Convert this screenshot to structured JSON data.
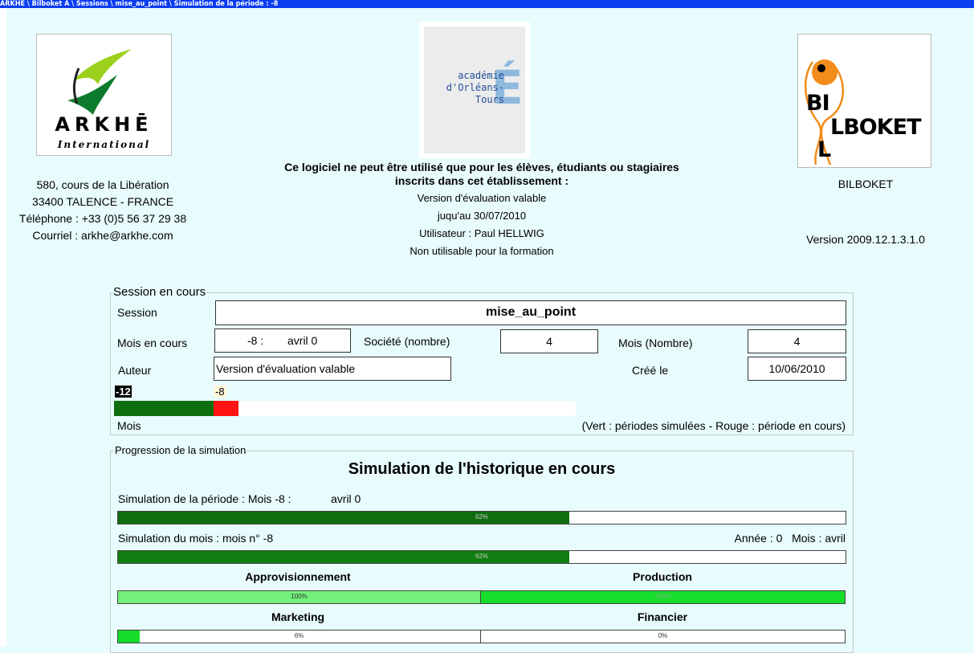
{
  "window": {
    "title": "ARKHE \\ Bilboket A \\ Sessions \\ mise_au_point \\ Simulation de la période : -8"
  },
  "logos": {
    "arkhe": {
      "name": "ARKHĒ",
      "tagline": "International"
    },
    "academie": {
      "line1": "académie",
      "line2": "d'Orléans-Tours",
      "letter": "É"
    },
    "bilboket": {
      "part1": "BI",
      "part2": "LBOKET",
      "part3": "L"
    }
  },
  "company": {
    "address": "580, cours de la Libération",
    "city": "33400 TALENCE - FRANCE",
    "phone": "Téléphone : +33 (0)5 56 37 29 38",
    "email": "Courriel : arkhe@arkhe.com"
  },
  "license": {
    "line1": "Ce logiciel ne peut être utilisé que pour les élèves, étudiants ou stagiaires",
    "line2": "inscrits dans cet établissement :",
    "line3": "Version d'évaluation valable",
    "line4": "juqu'au 30/07/2010",
    "line5": "Utilisateur : Paul HELLWIG",
    "line6": "Non utilisable pour la formation"
  },
  "product": {
    "name": "BILBOKET",
    "version": "Version 2009.12.1.3.1.0"
  },
  "session": {
    "group_title": "Session en cours",
    "session_label": "Session",
    "session_value": "mise_au_point",
    "month_label": "Mois en cours",
    "month_num": "-8 :",
    "month_name": "avril 0",
    "company_count_label": "Société (nombre)",
    "company_count": "4",
    "month_count_label": "Mois (Nombre)",
    "month_count": "4",
    "author_label": "Auteur",
    "author_value": "Version d'évaluation valable",
    "created_label": "Créé le",
    "created_value": "10/06/2010",
    "timeline_start": "-12",
    "timeline_current": "-8",
    "timeline_label": "Mois",
    "timeline_legend": "(Vert : périodes simulées - Rouge : période en cours)"
  },
  "progress": {
    "group_title": "Progression de la simulation",
    "heading": "Simulation de l'historique en cours",
    "period_label": "Simulation de la période : Mois -8 :",
    "period_month": "avril 0",
    "period_pct": "62%",
    "month_label": "Simulation du mois : mois n° -8",
    "month_info": "Année : 0   Mois : avril",
    "month_pct": "62%",
    "supply_label": "Approvisionnement",
    "supply_pct": "100%",
    "production_label": "Production",
    "production_pct": "100%",
    "marketing_label": "Marketing",
    "marketing_pct": "6%",
    "finance_label": "Financier",
    "finance_pct": "0%"
  },
  "colors": {
    "dark_green": "#0e6e0e",
    "light_green": "#72f07a",
    "bright_green": "#16dd2a",
    "red": "#ff1414",
    "title_blue": "#0a3cf0",
    "background": "#e8fbfd"
  }
}
